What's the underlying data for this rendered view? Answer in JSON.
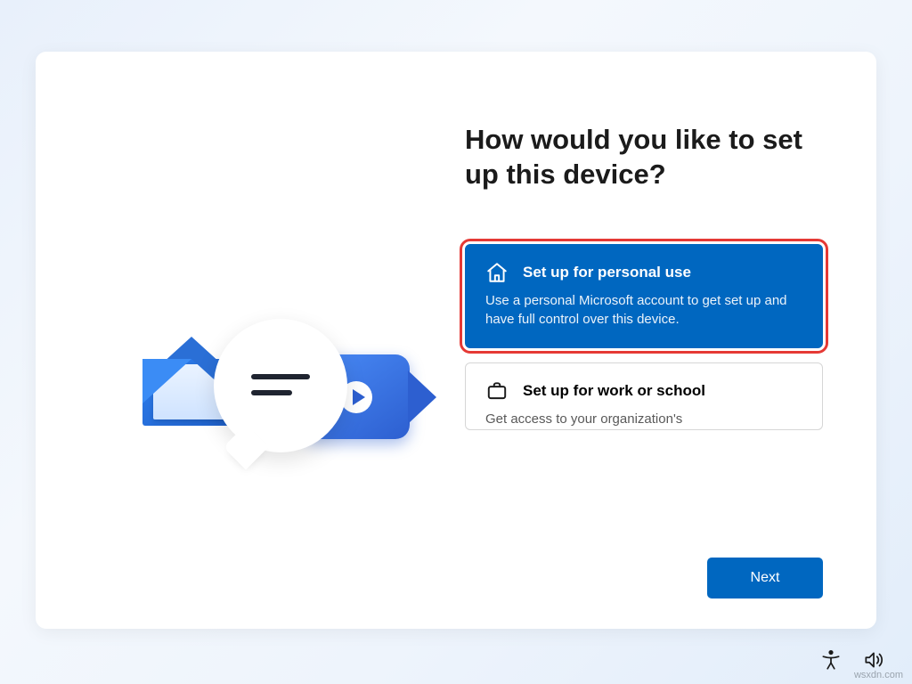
{
  "title": "How would you like to set up this device?",
  "options": [
    {
      "icon": "home-icon",
      "title": "Set up for personal use",
      "desc": "Use a personal Microsoft account to get set up and have full control over this device.",
      "selected": true
    },
    {
      "icon": "briefcase-icon",
      "title": "Set up for work or school",
      "desc": "Get access to your organization's",
      "selected": false
    }
  ],
  "next_label": "Next",
  "watermark": "wsxdn.com",
  "colors": {
    "accent": "#0067c0",
    "highlight": "#e53935"
  }
}
